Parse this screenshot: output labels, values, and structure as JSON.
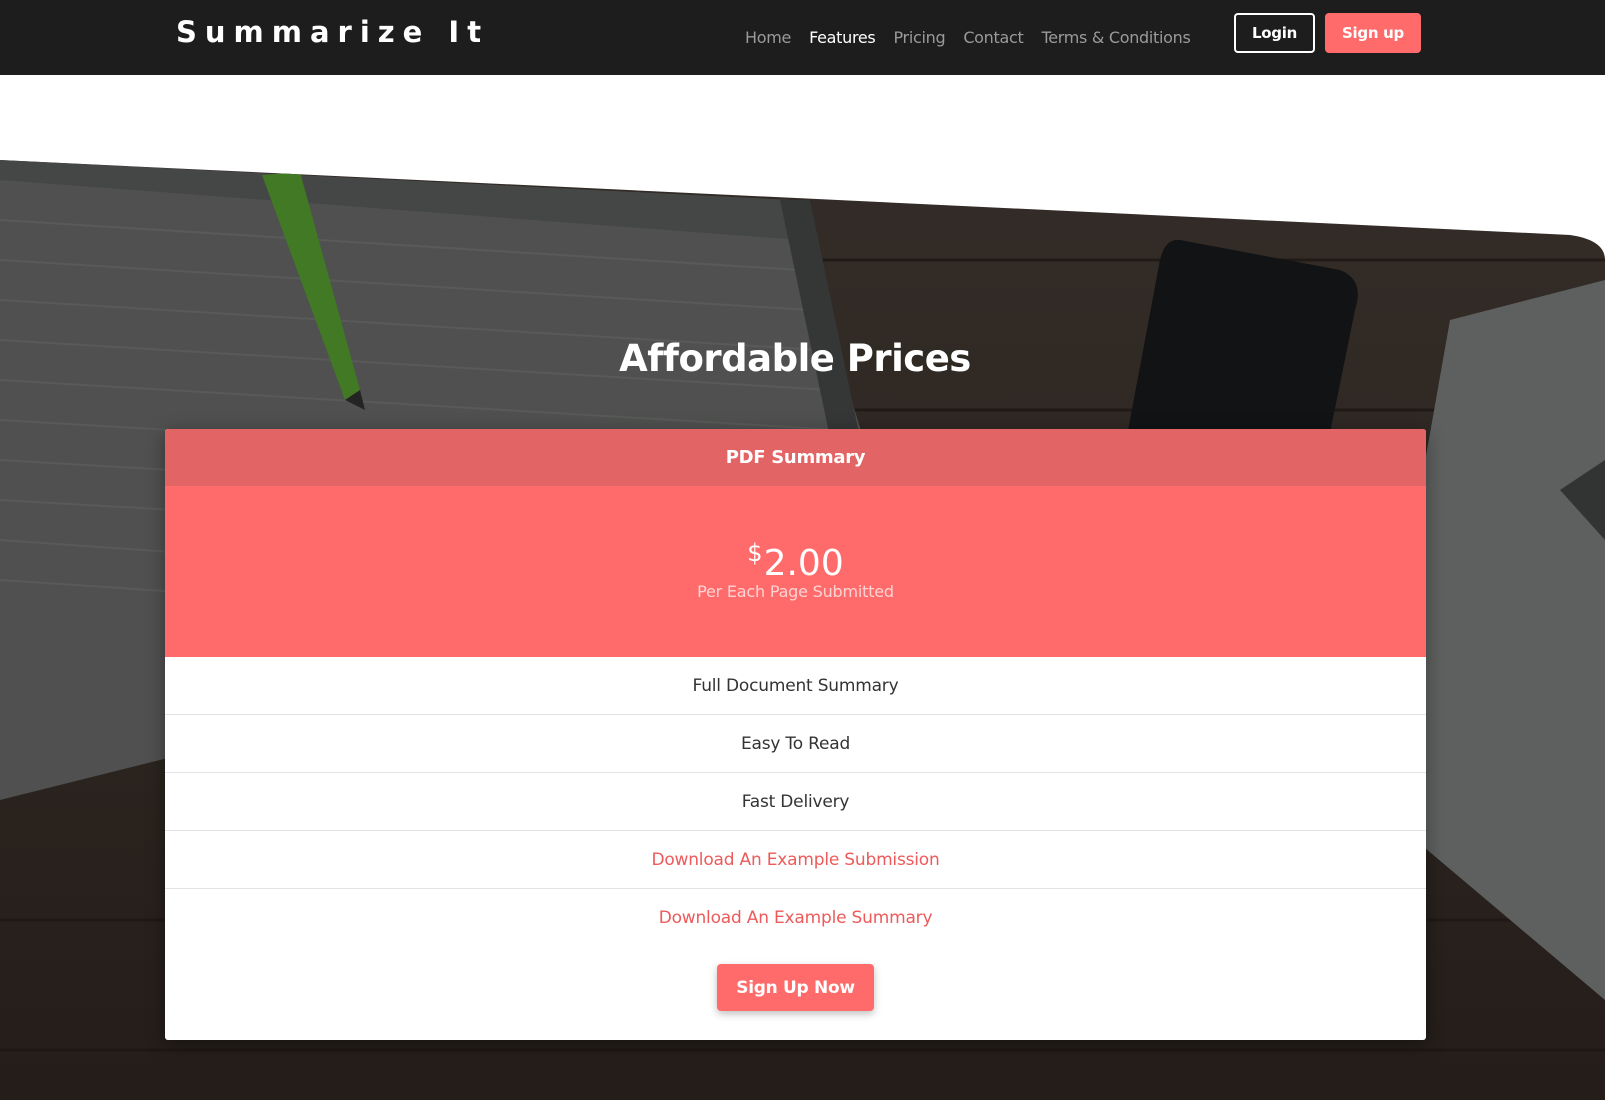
{
  "brand": "Summarize It",
  "nav": {
    "links": [
      {
        "label": "Home",
        "active": false
      },
      {
        "label": "Features",
        "active": true
      },
      {
        "label": "Pricing",
        "active": false
      },
      {
        "label": "Contact",
        "active": false
      },
      {
        "label": "Terms & Conditions",
        "active": false
      }
    ],
    "login_label": "Login",
    "signup_label": "Sign up"
  },
  "pricing": {
    "title": "Affordable Prices",
    "plan": {
      "name": "PDF Summary",
      "currency": "$",
      "amount": "2.00",
      "unit": "Per Each Page Submitted",
      "features": [
        "Full Document Summary",
        "Easy To Read",
        "Fast Delivery"
      ],
      "links": [
        "Download An Example Submission",
        "Download An Example Summary"
      ],
      "cta_label": "Sign Up Now"
    }
  },
  "colors": {
    "accent": "#ff6b6b",
    "card_header": "#e36464",
    "navbar": "#1d1d1d"
  }
}
